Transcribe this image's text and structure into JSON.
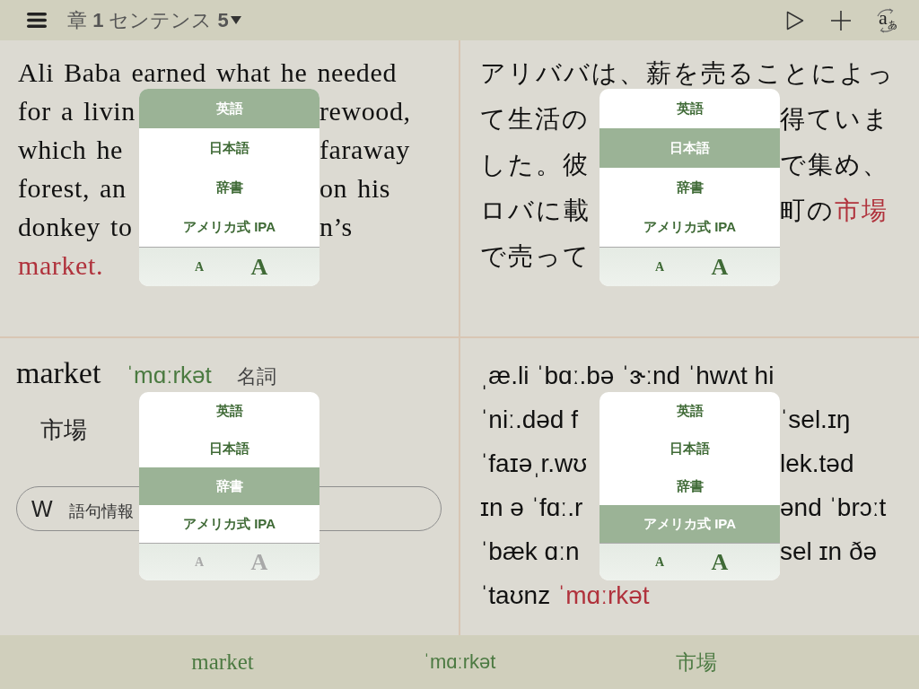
{
  "top_bar": {
    "title": "章 **1** センテンス **5**",
    "translate_button": {
      "latin": "a",
      "kana": "あ"
    }
  },
  "panels": [
    {
      "kind": "english",
      "lines": [
        {
          "left": [
            {
              "text": "Ali Baba earned what he needed",
              "highlighted": false
            }
          ]
        },
        {
          "left": [
            {
              "text": "for a livin",
              "highlighted": false
            }
          ],
          "right": [
            {
              "text": "rewood,",
              "highlighted": false
            }
          ]
        },
        {
          "left": [
            {
              "text": "which he",
              "highlighted": false
            }
          ],
          "right": [
            {
              "text": "faraway",
              "highlighted": false
            }
          ]
        },
        {
          "left": [
            {
              "text": "forest, an",
              "highlighted": false
            }
          ],
          "right": [
            {
              "text": "on his",
              "highlighted": false
            }
          ]
        },
        {
          "left": [
            {
              "text": "donkey to",
              "highlighted": false
            }
          ],
          "right": [
            {
              "text": "n’s",
              "highlighted": false
            }
          ]
        },
        {
          "left": [
            {
              "text": "market.",
              "highlighted": true
            }
          ]
        }
      ],
      "popover": {
        "options": [
          {
            "label": "英語",
            "selected": true
          },
          {
            "label": "日本語",
            "selected": false
          },
          {
            "label": "辞書",
            "selected": false
          },
          {
            "label": "アメリカ式 IPA",
            "selected": false
          }
        ],
        "size_buttons": [
          {
            "kind": "smaller",
            "label": "A",
            "disabled": false
          },
          {
            "kind": "larger",
            "label": "A",
            "disabled": false
          }
        ]
      }
    },
    {
      "kind": "japanese",
      "lines": [
        {
          "left": [
            {
              "text": "アリババは、薪を売ることによっ",
              "highlighted": false
            }
          ]
        },
        {
          "left": [
            {
              "text": "て生活の",
              "highlighted": false
            }
          ],
          "right": [
            {
              "text": "得ていま",
              "highlighted": false
            }
          ]
        },
        {
          "left": [
            {
              "text": "した。彼",
              "highlighted": false
            }
          ],
          "right": [
            {
              "text": "で集め、",
              "highlighted": false
            }
          ]
        },
        {
          "left": [
            {
              "text": "ロバに載",
              "highlighted": false
            }
          ],
          "right": [
            {
              "text": "町の",
              "highlighted": false
            },
            {
              "text": "市場",
              "highlighted": true
            }
          ]
        },
        {
          "left": [
            {
              "text": "で売って",
              "highlighted": false
            }
          ]
        }
      ],
      "popover": {
        "options": [
          {
            "label": "英語",
            "selected": false
          },
          {
            "label": "日本語",
            "selected": true
          },
          {
            "label": "辞書",
            "selected": false
          },
          {
            "label": "アメリカ式 IPA",
            "selected": false
          }
        ],
        "size_buttons": [
          {
            "kind": "smaller",
            "label": "A",
            "disabled": false
          },
          {
            "kind": "larger",
            "label": "A",
            "disabled": false
          }
        ]
      }
    },
    {
      "kind": "dictionary",
      "headword": "market",
      "pronunciation": "ˈmɑːrkət",
      "part_of_speech": "名詞",
      "meaning": "市場",
      "lookup_button": {
        "letter": "W",
        "label": "語句情報"
      },
      "popover": {
        "options": [
          {
            "label": "英語",
            "selected": false
          },
          {
            "label": "日本語",
            "selected": false
          },
          {
            "label": "辞書",
            "selected": true
          },
          {
            "label": "アメリカ式 IPA",
            "selected": false
          }
        ],
        "size_buttons": [
          {
            "kind": "smaller",
            "label": "A",
            "disabled": true
          },
          {
            "kind": "larger",
            "label": "A",
            "disabled": true
          }
        ]
      }
    },
    {
      "kind": "ipa",
      "lines": [
        {
          "left": [
            {
              "text": "ˌæ.li ˈbɑː.bə ˈɝːnd ˈhwʌt hi",
              "highlighted": false
            }
          ]
        },
        {
          "left": [
            {
              "text": "ˈniː.dəd f",
              "highlighted": false
            }
          ],
          "right": [
            {
              "text": "ˈsel.ɪŋ",
              "highlighted": false
            }
          ]
        },
        {
          "left": [
            {
              "text": "ˈfaɪəˌr.wʊ",
              "highlighted": false
            }
          ],
          "right": [
            {
              "text": "lek.təd",
              "highlighted": false
            }
          ]
        },
        {
          "left": [
            {
              "text": "ɪn ə ˈfɑː.r",
              "highlighted": false
            }
          ],
          "right": [
            {
              "text": "ənd ˈbrɔːt",
              "highlighted": false
            }
          ]
        },
        {
          "left": [
            {
              "text": "ˈbæk ɑːn",
              "highlighted": false
            }
          ],
          "right": [
            {
              "text": "sel ɪn ðə",
              "highlighted": false
            }
          ]
        },
        {
          "left": [
            {
              "text": "ˈtaʊnz ",
              "highlighted": false
            },
            {
              "text": "ˈmɑːrkət",
              "highlighted": true
            }
          ]
        }
      ],
      "popover": {
        "options": [
          {
            "label": "英語",
            "selected": false
          },
          {
            "label": "日本語",
            "selected": false
          },
          {
            "label": "辞書",
            "selected": false
          },
          {
            "label": "アメリカ式 IPA",
            "selected": true
          }
        ],
        "size_buttons": [
          {
            "kind": "smaller",
            "label": "A",
            "disabled": false
          },
          {
            "kind": "larger",
            "label": "A",
            "disabled": false
          }
        ]
      }
    }
  ],
  "bottom_bar": {
    "items": [
      {
        "kind": "word",
        "text": "market"
      },
      {
        "kind": "pronunciation",
        "text": "ˈmɑːrkət"
      },
      {
        "kind": "meaning",
        "text": "市場"
      }
    ]
  }
}
